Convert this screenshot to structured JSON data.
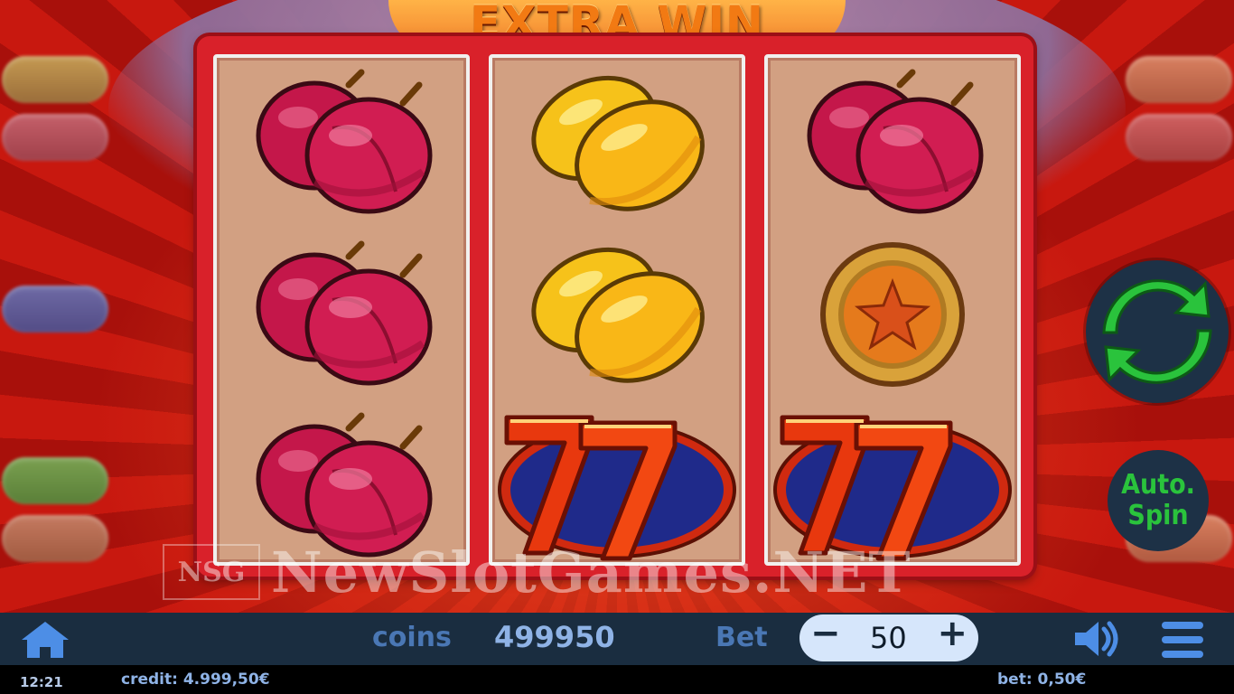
{
  "game": {
    "title": "EXTRA WIN",
    "watermark_logo": "NSG",
    "watermark_text": "NewSlotGames.NET"
  },
  "reels": [
    {
      "symbols": [
        "plum",
        "plum",
        "plum"
      ]
    },
    {
      "symbols": [
        "lemon",
        "lemon",
        "seven"
      ]
    },
    {
      "symbols": [
        "plum",
        "star-coin",
        "seven"
      ]
    }
  ],
  "controls": {
    "spin_icon": "refresh-icon",
    "auto_spin_line1": "Auto.",
    "auto_spin_line2": "Spin"
  },
  "bottom_bar": {
    "coins_label": "coins",
    "coins_value": "499950",
    "bet_label": "Bet",
    "bet_value": "50",
    "minus": "−",
    "plus": "+"
  },
  "status_bar": {
    "time": "12:21",
    "credit": "credit: 4.999,50€",
    "bet": "bet: 0,50€"
  },
  "colors": {
    "accent_green": "#2ac33c",
    "bar_bg": "#1a2d40",
    "frame_red": "#d9212a"
  }
}
